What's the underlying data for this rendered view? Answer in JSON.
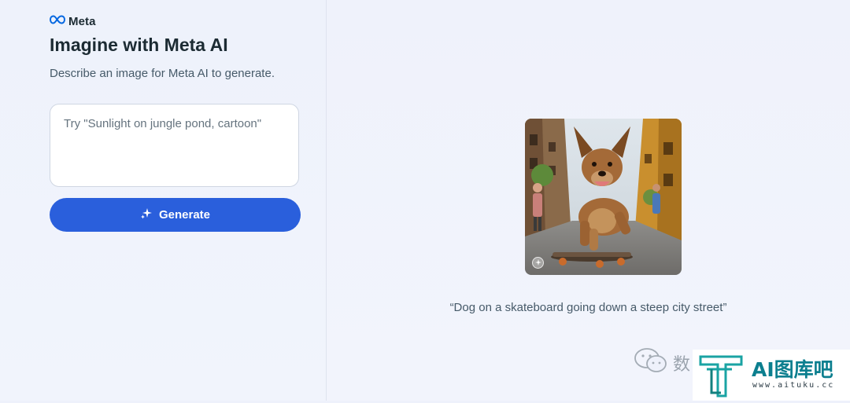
{
  "brand": {
    "name": "Meta",
    "logo_icon": "meta-infinity-icon"
  },
  "header": {
    "title": "Imagine with Meta AI",
    "subtitle": "Describe an image for Meta AI to generate."
  },
  "prompt": {
    "placeholder": "Try \"Sunlight on jungle pond, cartoon\"",
    "value": ""
  },
  "generate_button": {
    "label": "Generate",
    "icon": "sparkle-icon"
  },
  "preview": {
    "caption": "“Dog on a skateboard going down a steep city street”",
    "image_subject": "dog on skateboard",
    "overlay_icon": "sparkle-badge-icon"
  },
  "watermark": {
    "text": "数",
    "icon": "wechat-icon",
    "badge_label": "AI图库吧",
    "badge_url": "www.aituku.cc",
    "badge_logo": "tt-logo-icon"
  },
  "colors": {
    "accent": "#2a5fdc",
    "text_primary": "#1c2b33",
    "text_secondary": "#465a69",
    "background": "#eef1fb",
    "badge_teal": "#0c7f8f"
  }
}
